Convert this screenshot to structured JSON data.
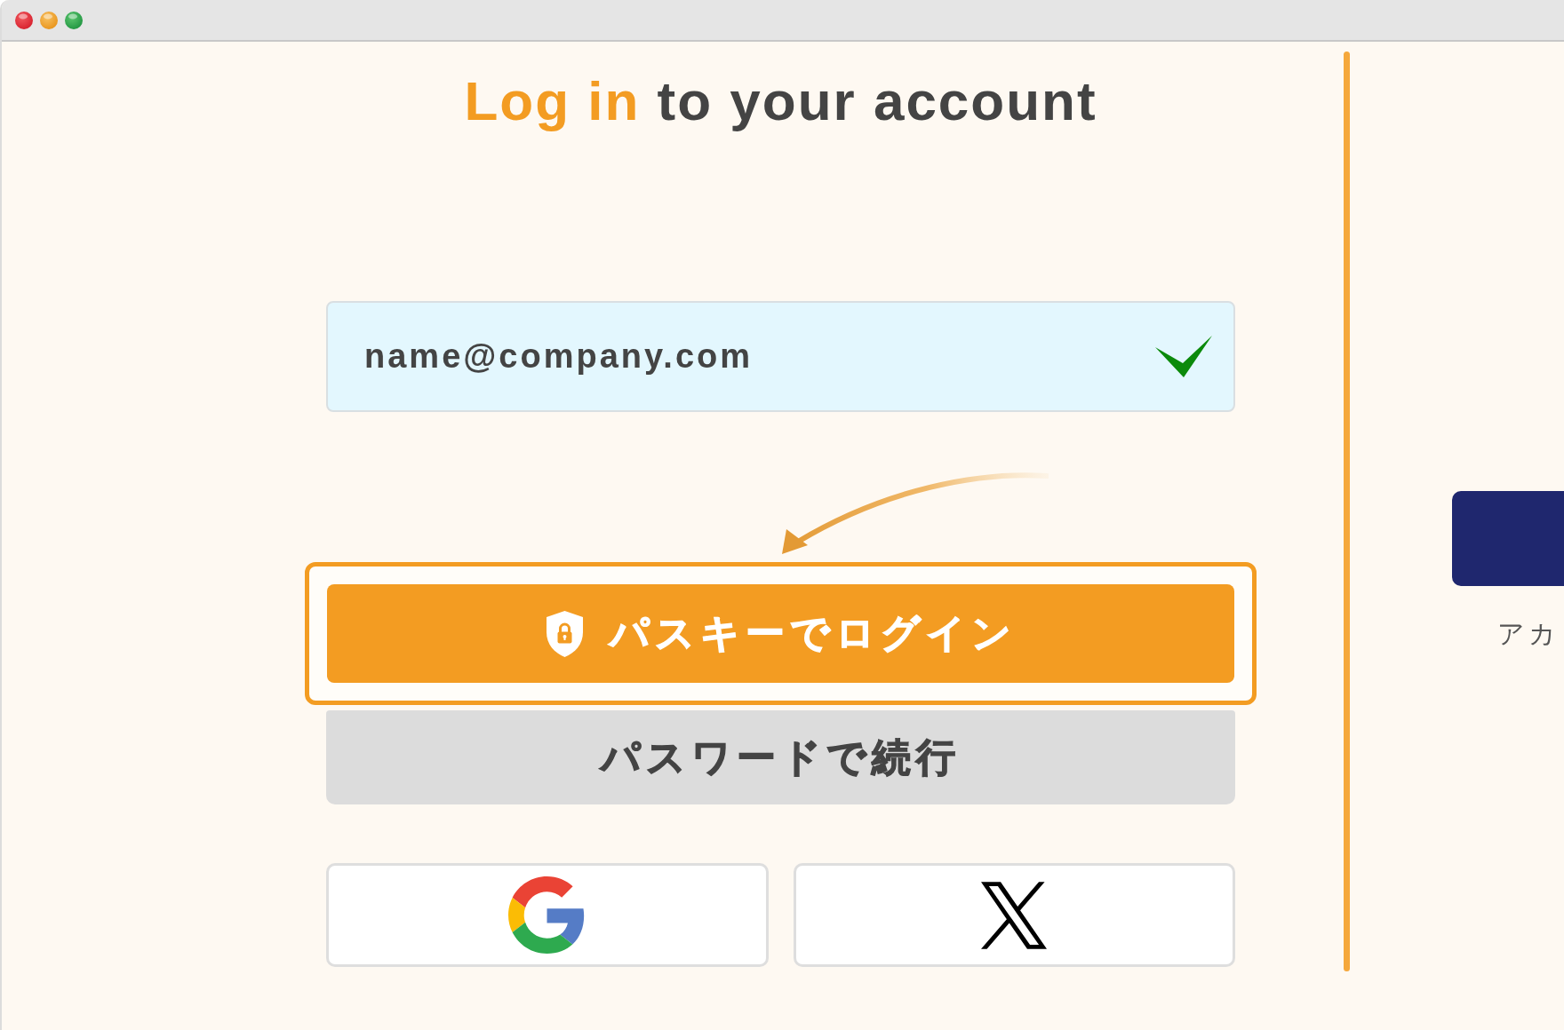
{
  "heading": {
    "accent": "Log in",
    "text": "to your account"
  },
  "email_field": {
    "value": "name@company.com",
    "valid": true
  },
  "buttons": [
    {
      "kind": "passkey",
      "label": "パスキーでログイン",
      "highlighted": true
    },
    {
      "kind": "password",
      "label": "パスワードで続行",
      "highlighted": false
    }
  ],
  "social_logins": [
    {
      "kind": "google"
    },
    {
      "kind": "x"
    }
  ],
  "side_panel": {
    "caption": "アカ"
  }
}
